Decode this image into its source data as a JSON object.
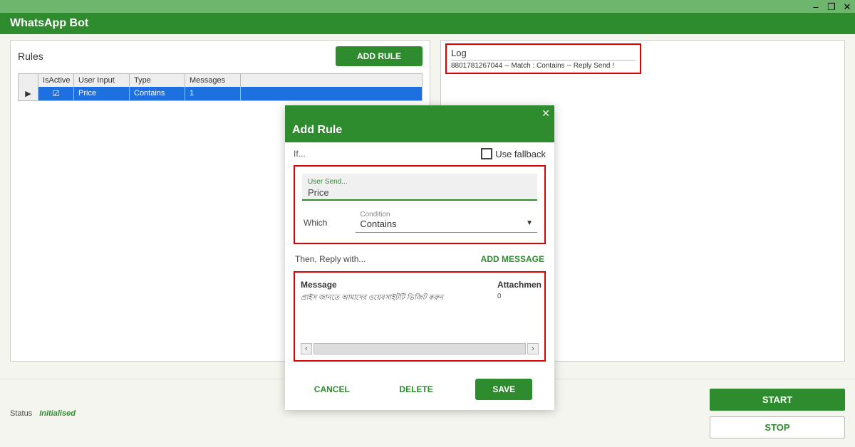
{
  "window": {
    "minimize": "–",
    "maximize": "❐",
    "close": "✕"
  },
  "app": {
    "title": "WhatsApp Bot"
  },
  "rules": {
    "title": "Rules",
    "add_rule": "ADD RULE",
    "headers": {
      "active": "IsActive",
      "userinput": "User Input",
      "type": "Type",
      "messages": "Messages"
    },
    "row": {
      "arrow": "▶",
      "active_check": "☑",
      "userinput": "Price",
      "type": "Contains",
      "messages": "1"
    }
  },
  "log": {
    "title": "Log",
    "line": "8801781267044    -- Match :           Contains   -- Reply Send !"
  },
  "modal": {
    "close": "✕",
    "title": "Add Rule",
    "if_label": "If...",
    "fallback_label": "Use fallback",
    "user_send_label": "User Send...",
    "user_send_value": "Price",
    "which_label": "Which",
    "condition_label": "Condition",
    "condition_value": "Contains",
    "then_label": "Then, Reply with...",
    "add_message": "ADD MESSAGE",
    "msg_header1": "Message",
    "msg_header2": "Attachmen",
    "msg_value": "প্রাইস জানতে আমাদের ওয়েবসাইটটি ভিজিট করুন",
    "msg_attach": "0",
    "scroll_left": "‹",
    "scroll_right": "›",
    "cancel": "CANCEL",
    "delete": "DELETE",
    "save": "SAVE"
  },
  "footer": {
    "status_label": "Status",
    "status_value": "Initialised",
    "start": "START",
    "stop": "STOP"
  }
}
